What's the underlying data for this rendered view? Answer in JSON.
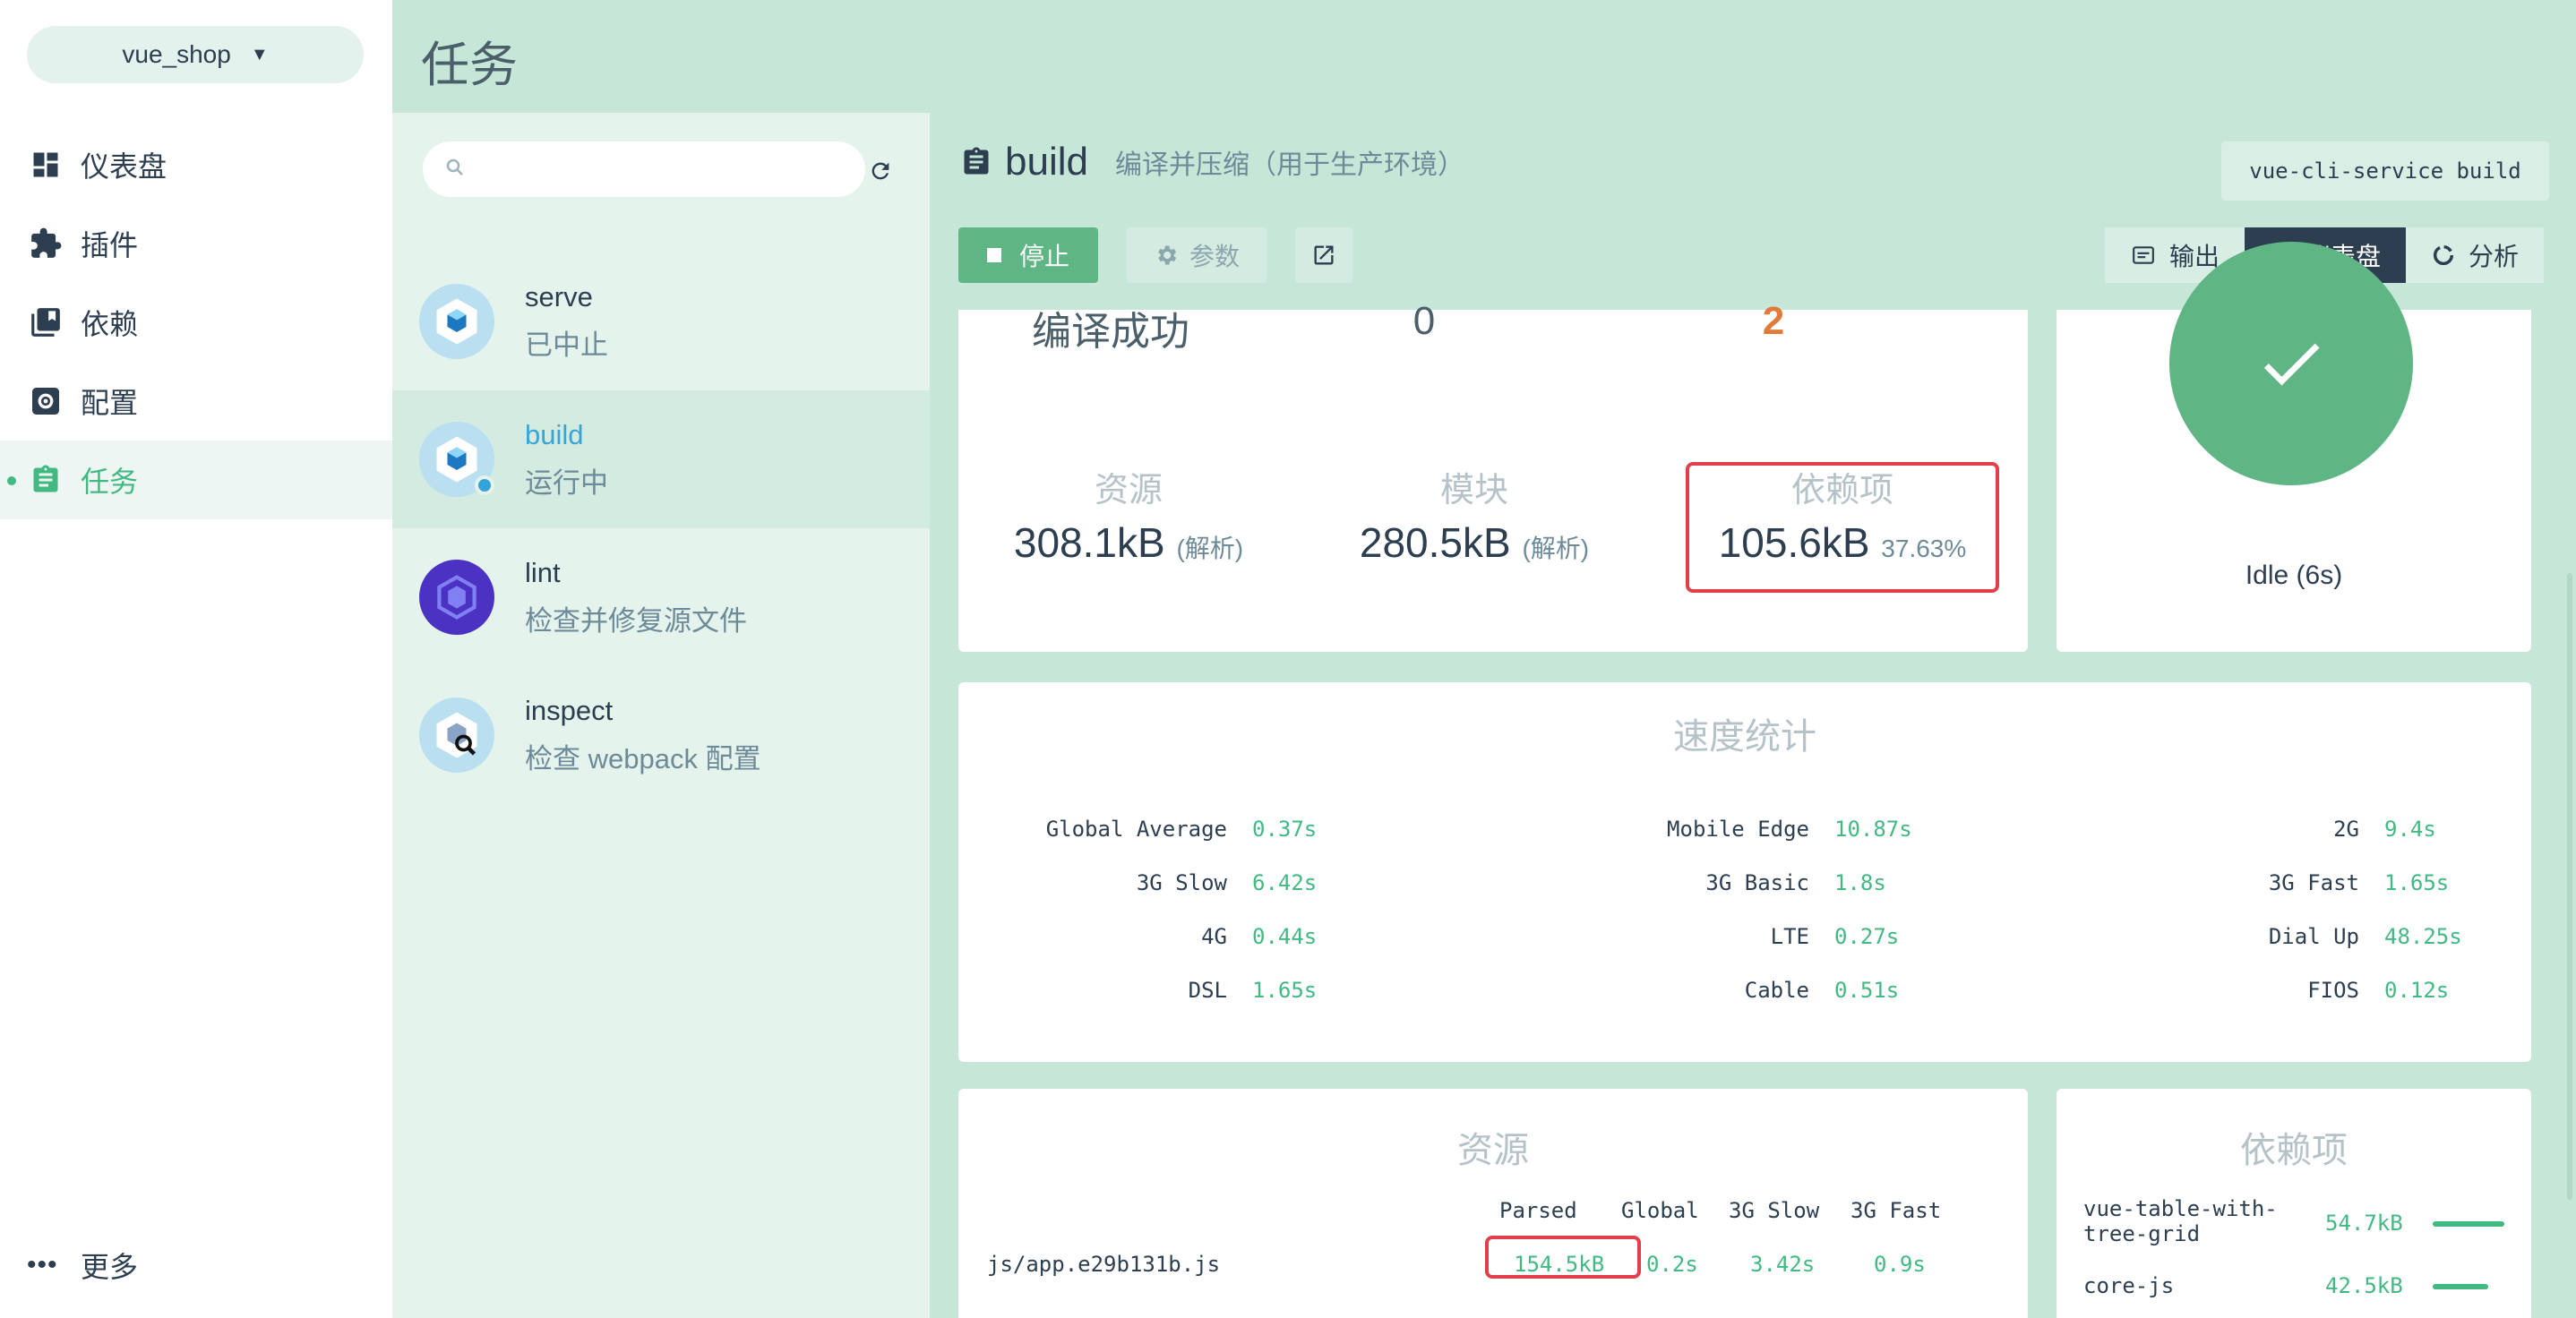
{
  "sidebar": {
    "project": "vue_shop",
    "items": [
      {
        "label": "仪表盘"
      },
      {
        "label": "插件"
      },
      {
        "label": "依赖"
      },
      {
        "label": "配置"
      },
      {
        "label": "任务"
      }
    ],
    "more": "更多"
  },
  "page_title": "任务",
  "tasklist": {
    "search_placeholder": "",
    "tasks": [
      {
        "name": "serve",
        "desc": "已中止"
      },
      {
        "name": "build",
        "desc": "运行中"
      },
      {
        "name": "lint",
        "desc": "检查并修复源文件"
      },
      {
        "name": "inspect",
        "desc": "检查 webpack 配置"
      }
    ]
  },
  "task_header": {
    "name": "build",
    "description": "编译并压缩（用于生产环境）",
    "command": "vue-cli-service build"
  },
  "toolbar": {
    "stop": "停止",
    "args": "参数",
    "tabs": [
      "输出",
      "仪表盘",
      "分析"
    ]
  },
  "status": {
    "label": "编译成功",
    "errors": "0",
    "warnings": "2",
    "assets_label": "资源",
    "assets_value": "308.1kB",
    "assets_note": "(解析)",
    "modules_label": "模块",
    "modules_value": "280.5kB",
    "modules_note": "(解析)",
    "deps_label": "依赖项",
    "deps_value": "105.6kB",
    "deps_pct": "37.63%",
    "idle": "Idle (6s)"
  },
  "speed": {
    "title": "速度统计",
    "rows": [
      {
        "k": "Global Average",
        "v": "0.37s"
      },
      {
        "k": "Mobile Edge",
        "v": "10.87s"
      },
      {
        "k": "2G",
        "v": "9.4s"
      },
      {
        "k": "3G Slow",
        "v": "6.42s"
      },
      {
        "k": "3G Basic",
        "v": "1.8s"
      },
      {
        "k": "3G Fast",
        "v": "1.65s"
      },
      {
        "k": "4G",
        "v": "0.44s"
      },
      {
        "k": "LTE",
        "v": "0.27s"
      },
      {
        "k": "Dial Up",
        "v": "48.25s"
      },
      {
        "k": "DSL",
        "v": "1.65s"
      },
      {
        "k": "Cable",
        "v": "0.51s"
      },
      {
        "k": "FIOS",
        "v": "0.12s"
      }
    ]
  },
  "assets": {
    "title": "资源",
    "headers": [
      "Parsed",
      "Global",
      "3G Slow",
      "3G Fast"
    ],
    "row": {
      "file": "js/app.e29b131b.js",
      "parsed": "154.5kB",
      "global": "0.2s",
      "slow": "3.42s",
      "fast": "0.9s"
    }
  },
  "deps": {
    "title": "依赖项",
    "items": [
      {
        "name": "vue-table-with-\ntree-grid",
        "size": "54.7kB"
      },
      {
        "name": "core-js",
        "size": "42.5kB"
      }
    ]
  },
  "colors": {
    "accent": "#42b983",
    "highlight": "#e0404a",
    "warning": "#e07b39",
    "dark": "#2c3e50"
  }
}
